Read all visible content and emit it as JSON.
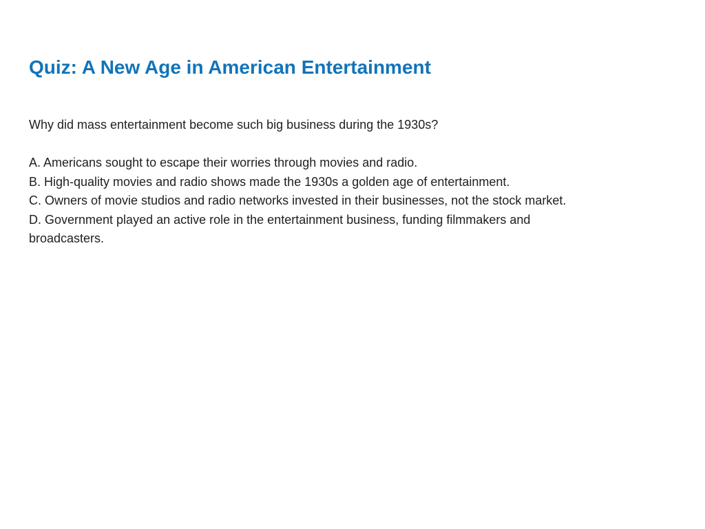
{
  "colors": {
    "title": "#1273b9",
    "text": "#1f1f1f",
    "background": "#ffffff"
  },
  "slide": {
    "title": "Quiz: A New Age in American Entertainment",
    "question": "Why did mass entertainment become such big business during the 1930s?",
    "choices": [
      "A.  Americans sought to escape their worries through movies and radio.",
      "B.  High-quality movies and radio shows made the 1930s a golden age of entertainment.",
      "C.  Owners of movie studios and radio networks invested in their businesses, not the stock market.",
      "D.  Government played an active role in the entertainment business, funding filmmakers and broadcasters."
    ]
  }
}
